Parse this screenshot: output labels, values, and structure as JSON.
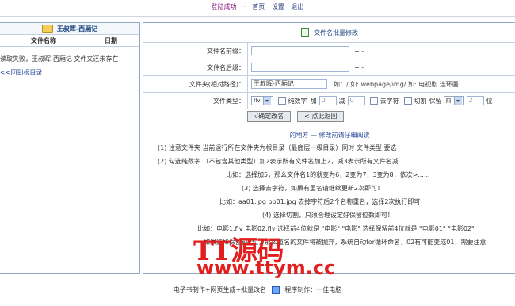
{
  "topbar": {
    "status": "登陆成功",
    "sep1": "·",
    "home": "首页",
    "settings": "设置",
    "logout": "退出"
  },
  "left_panel": {
    "folder_title": "王叔晖-西厢记",
    "col_filename": "文件名称",
    "col_date": "日期",
    "error_msg": "读取失败，王叔晖-西厢记 文件夹还未存在！",
    "back_link": "<<回到根目录"
  },
  "right_panel": {
    "title": "文件名批量修改",
    "prefix_label": "文件名前缀：",
    "prefix_value": "",
    "prefix_pm": "+ -",
    "suffix_label": "文件名后缀：",
    "suffix_value": "",
    "suffix_pm": "+ -",
    "folder_label": "文件夹(相对路径)：",
    "folder_value": "王叔晖-西厢记",
    "folder_hint": "如：/ 如: webpage/img/ 如: 电视剧 连环画",
    "type_label": "文件类型：",
    "type_value": "flv",
    "pure_digits": "纯数字",
    "add": "加",
    "add_value": "0",
    "sub": "减",
    "sub_value": "0",
    "remove_char": "去字符",
    "cut": "切割",
    "keep": "保留",
    "keep_select": "前",
    "keep_num": "2",
    "digits": "位",
    "confirm_btn": "√确定改名",
    "back_btn": "< 点此返回"
  },
  "notes": {
    "title": "的地方 — 修改前请仔细阅读",
    "lines": [
      "(1) 注意文件夹                  当前运行所在文件夹为根目录（最底层一级目录）同时  文件类型  要选",
      "(2) 勾选纯数字                  （不包含其他类型）加2表示所有文件名加上2，减3表示所有文件名减",
      "比如：选择加5，那么文件名1的就变为6，2变为7，3变为8，依次>......",
      "(3) 选择去字符，如果有重名请继续更新2次即可！",
      "比如：aa01.jpg bb01.jpg 去掉字符后2个名称重名，选择2次执行即可",
      "(4) 选择切割，只须合理设定好保留位数即可！",
      "比如：电影1.flv 电影02.flv  选择前4位就是 \"电影\"  \"电影\"  选择保留前4位就是 \"电影01\"  \"电影02\"",
      "如果选择保留前2位，那么重名的文件将被抛弃，系统自动for循环命名，02有可能变成01，需要注意"
    ]
  },
  "watermark": {
    "line1": "TT源码",
    "line2": "www.ttym.cc"
  },
  "footer": {
    "text1": "电子书制作+网页生成+批量改名",
    "text2": "程序制作：一佳电脑"
  }
}
